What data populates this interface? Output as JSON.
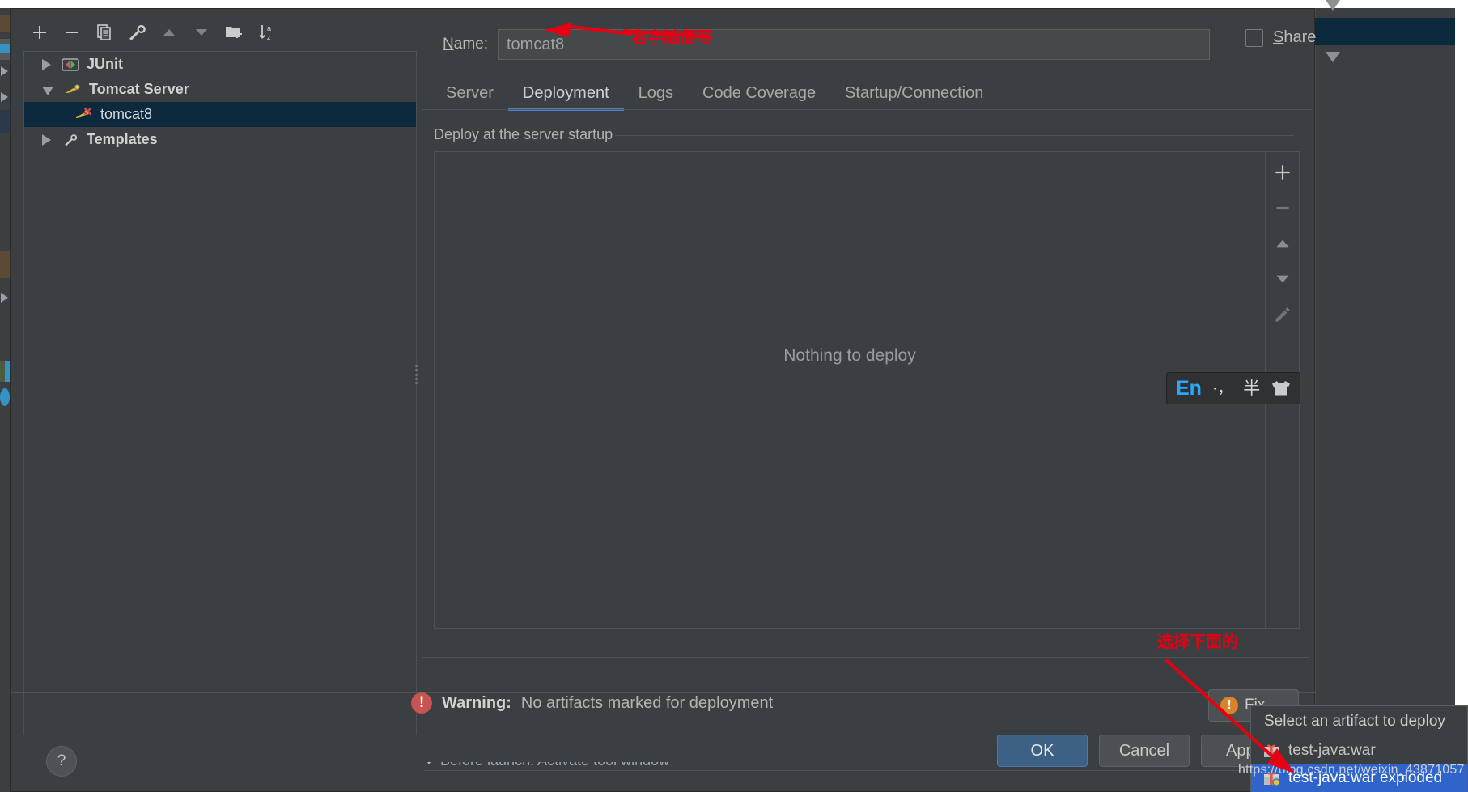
{
  "dialog": {
    "name_label": "Name:",
    "name_value": "tomcat8",
    "share_label": "Share",
    "help_label": "?"
  },
  "tree_toolbar": [
    {
      "name": "add",
      "icon": "plus-icon"
    },
    {
      "name": "remove",
      "icon": "minus-icon"
    },
    {
      "name": "copy",
      "icon": "copy-icon"
    },
    {
      "name": "edit-template",
      "icon": "wrench-icon"
    },
    {
      "name": "move-up",
      "icon": "triangle-up-icon"
    },
    {
      "name": "move-down",
      "icon": "triangle-down-icon"
    },
    {
      "name": "new-folder",
      "icon": "folder-add-icon"
    },
    {
      "name": "sort",
      "icon": "sort-az-icon"
    }
  ],
  "tree": {
    "items": [
      {
        "label": "JUnit",
        "icon": "junit-icon",
        "expanded": false,
        "level": 0,
        "selected": false
      },
      {
        "label": "Tomcat Server",
        "icon": "tomcat-icon",
        "expanded": true,
        "level": 0,
        "selected": false
      },
      {
        "label": "tomcat8",
        "icon": "tomcat-error-icon",
        "expanded": null,
        "level": 1,
        "selected": true
      },
      {
        "label": "Templates",
        "icon": "wrench-icon",
        "expanded": false,
        "level": 0,
        "selected": false
      }
    ]
  },
  "tabs": [
    {
      "label": "Server",
      "active": false
    },
    {
      "label": "Deployment",
      "active": true
    },
    {
      "label": "Logs",
      "active": false
    },
    {
      "label": "Code Coverage",
      "active": false
    },
    {
      "label": "Startup/Connection",
      "active": false
    }
  ],
  "deployment": {
    "caption": "Deploy at the server startup",
    "empty_text": "Nothing to deploy",
    "toolbar": [
      {
        "name": "add-artifact",
        "icon": "plus-icon"
      },
      {
        "name": "remove-artifact",
        "icon": "minus-icon"
      },
      {
        "name": "move-up",
        "icon": "triangle-up-icon"
      },
      {
        "name": "move-down",
        "icon": "triangle-down-icon"
      },
      {
        "name": "edit-artifact",
        "icon": "pencil-icon"
      }
    ],
    "before_launch": "Before launch: Activate tool window"
  },
  "warning": {
    "icon": "error-icon",
    "prefix": "Warning:",
    "message": "No artifacts marked for deployment"
  },
  "buttons": {
    "ok": "OK",
    "cancel": "Cancel",
    "apply": "Apply",
    "fix": "Fix"
  },
  "popup": {
    "title": "Select an artifact to deploy",
    "items": [
      {
        "label": "test-java:war",
        "selected": false
      },
      {
        "label": "test-java:war exploded",
        "selected": true
      }
    ]
  },
  "ime": {
    "language": "En",
    "punctuation": "·，",
    "width_mode": "半",
    "skin": "shirt-icon"
  },
  "annotations": [
    {
      "text": "名字随便写",
      "target": "name-field"
    },
    {
      "text": "选择下面的",
      "target": "artifact-popup"
    }
  ],
  "watermark": "https://blog.csdn.net/weixin_43871057",
  "colors": {
    "accent_blue": "#4a88c7",
    "selection_blue": "#2f65ca",
    "tree_selection": "#0d293e",
    "warning_red": "#c75450",
    "annotation_red": "#e60012",
    "panel_bg": "#3c3f41"
  }
}
